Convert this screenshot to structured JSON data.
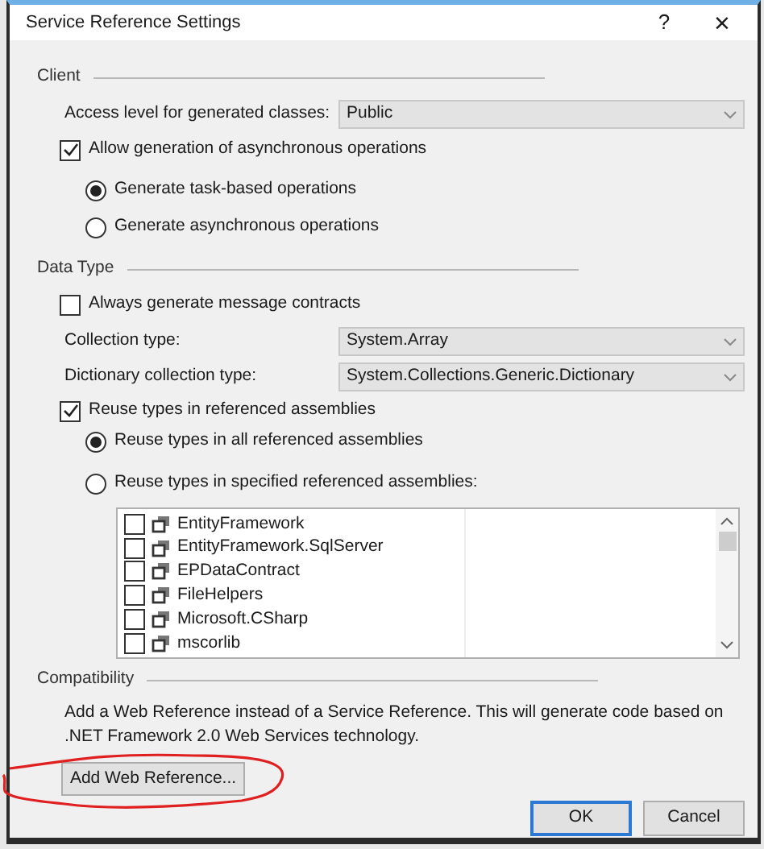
{
  "window": {
    "title": "Service Reference Settings",
    "help": "?",
    "close": "×"
  },
  "client": {
    "heading": "Client",
    "access_label": "Access level for generated classes:",
    "access_value": "Public",
    "allow_async": {
      "label": "Allow generation of asynchronous operations",
      "checked": true
    },
    "async_options": [
      {
        "label": "Generate task-based operations",
        "selected": true
      },
      {
        "label": "Generate asynchronous operations",
        "selected": false
      }
    ]
  },
  "data_type": {
    "heading": "Data Type",
    "always_generate": {
      "label": "Always generate message contracts",
      "checked": false
    },
    "dropdowns": [
      {
        "label": "Collection type:",
        "value": "System.Array"
      },
      {
        "label": "Dictionary collection type:",
        "value": "System.Collections.Generic.Dictionary"
      }
    ],
    "reuse": {
      "label": "Reuse types in referenced assemblies",
      "checked": true
    },
    "reuse_options": [
      {
        "label": "Reuse types in all referenced assemblies",
        "selected": true
      },
      {
        "label": "Reuse types in specified referenced assemblies:",
        "selected": false
      }
    ],
    "assemblies": [
      {
        "name": "EntityFramework",
        "checked": false
      },
      {
        "name": "EntityFramework.SqlServer",
        "checked": false
      },
      {
        "name": "EPDataContract",
        "checked": false
      },
      {
        "name": "FileHelpers",
        "checked": false
      },
      {
        "name": "Microsoft.CSharp",
        "checked": false
      },
      {
        "name": "mscorlib",
        "checked": false
      }
    ]
  },
  "compatibility": {
    "heading": "Compatibility",
    "description": "Add a Web Reference instead of a Service Reference. This will generate code based on .NET Framework 2.0 Web Services technology.",
    "button": "Add Web Reference..."
  },
  "buttons": [
    {
      "label": "OK",
      "default": true
    },
    {
      "label": "Cancel",
      "default": false
    }
  ]
}
